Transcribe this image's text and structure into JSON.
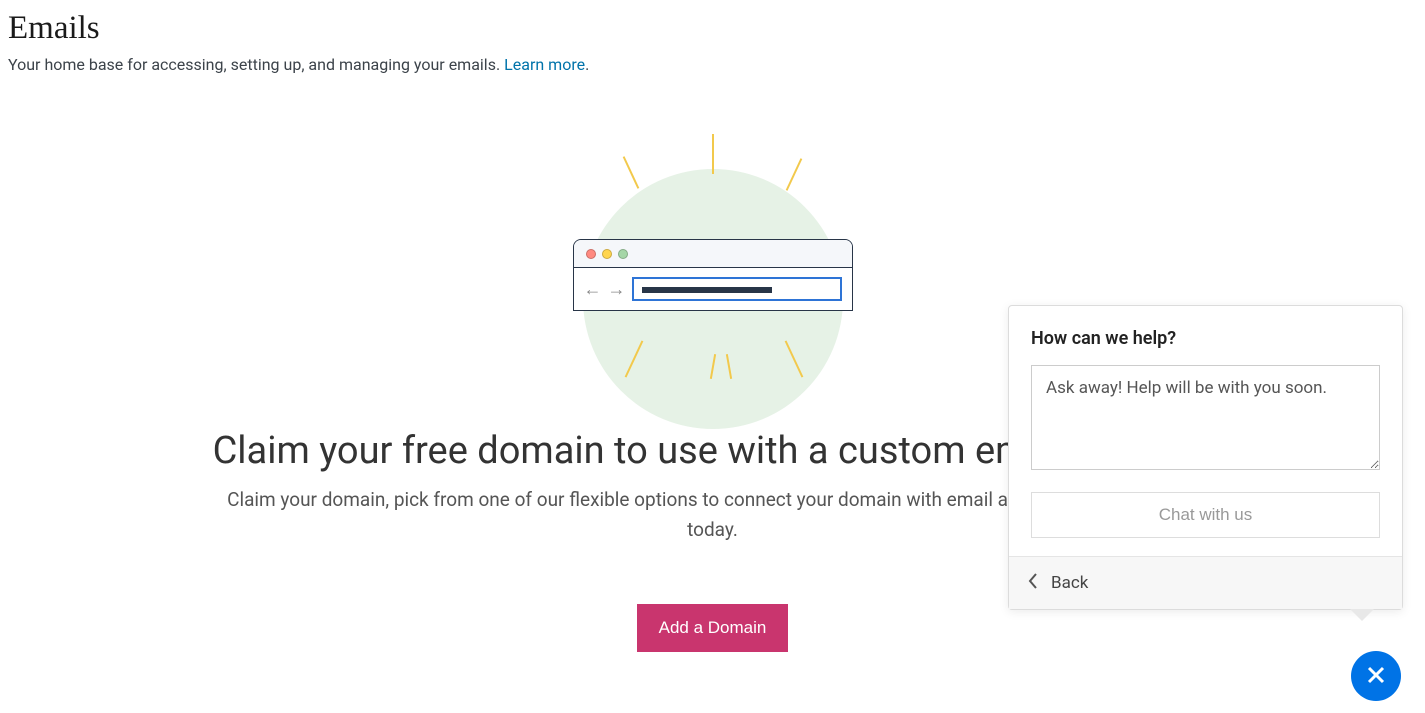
{
  "header": {
    "title": "Emails",
    "subtitle_prefix": "Your home base for accessing, setting up, and managing your emails. ",
    "learn_more": "Learn more",
    "period": "."
  },
  "hero": {
    "title": "Claim your free domain to use with a custom email address",
    "subtitle": "Claim your domain, pick from one of our flexible options to connect your domain with email and start getting emails today.",
    "button": "Add a Domain"
  },
  "help": {
    "title": "How can we help?",
    "placeholder": "Ask away! Help will be with you soon.",
    "chat_button": "Chat with us",
    "back_label": "Back"
  },
  "icons": {
    "close": "close-icon",
    "chevron_left": "chevron-left-icon"
  },
  "colors": {
    "primary_button": "#c9356e",
    "fab": "#0073e6",
    "link": "#0073aa"
  }
}
